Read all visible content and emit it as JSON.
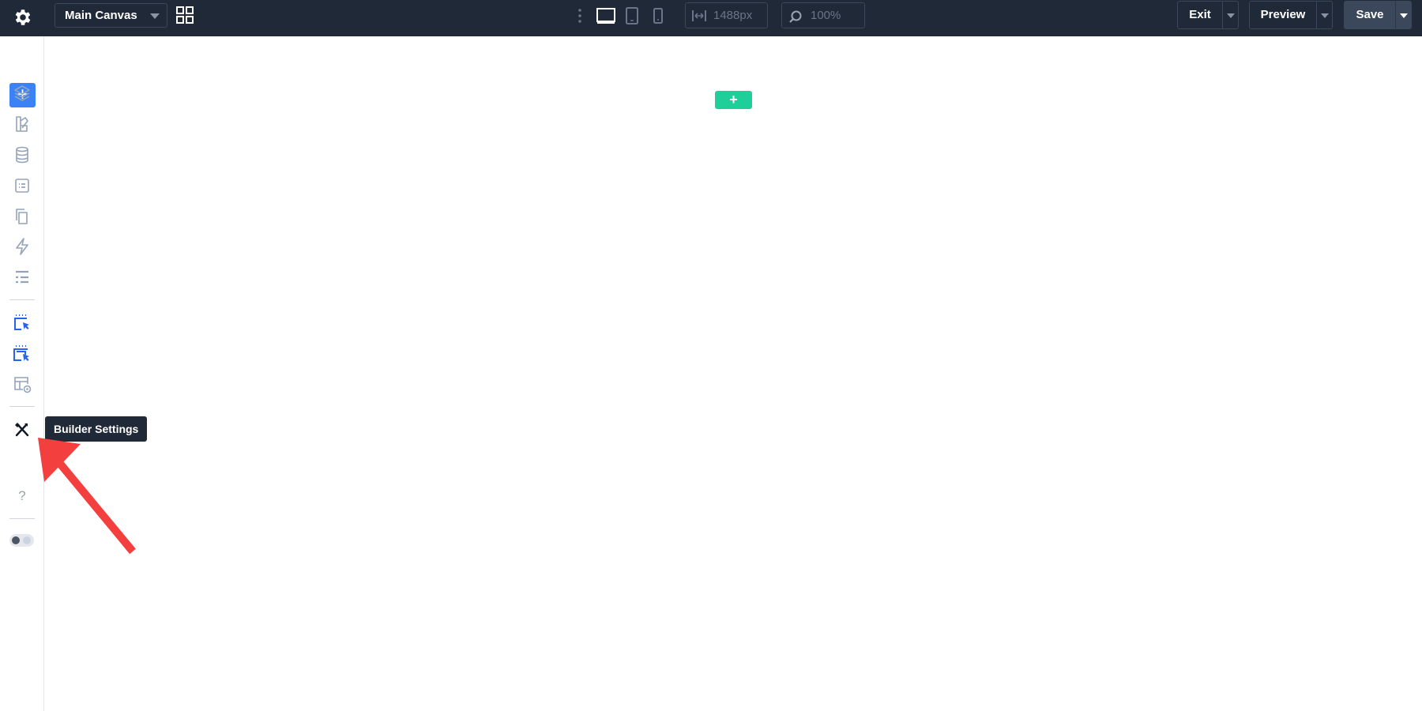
{
  "topbar": {
    "canvas_select": "Main Canvas",
    "width_value": "1488px",
    "zoom_value": "100%",
    "exit_label": "Exit",
    "preview_label": "Preview",
    "save_label": "Save"
  },
  "sidebar": {
    "add_label": "+",
    "items": [
      {
        "icon": "layers-icon"
      },
      {
        "icon": "components-icon"
      },
      {
        "icon": "database-icon"
      },
      {
        "icon": "form-icon"
      },
      {
        "icon": "pages-icon"
      },
      {
        "icon": "interactions-icon"
      },
      {
        "icon": "styles-icon"
      },
      {
        "icon": "select-parent-icon"
      },
      {
        "icon": "select-children-icon"
      },
      {
        "icon": "template-preview-icon"
      },
      {
        "icon": "builder-settings-icon"
      }
    ],
    "help_label": "?"
  },
  "tooltip": "Builder Settings",
  "canvas": {
    "add_section_label": "+"
  },
  "colors": {
    "topbar_bg": "#1f2937",
    "accent_blue": "#3b82f6",
    "accent_green": "#1fcf9a",
    "annotation_red": "#f43f3f"
  }
}
